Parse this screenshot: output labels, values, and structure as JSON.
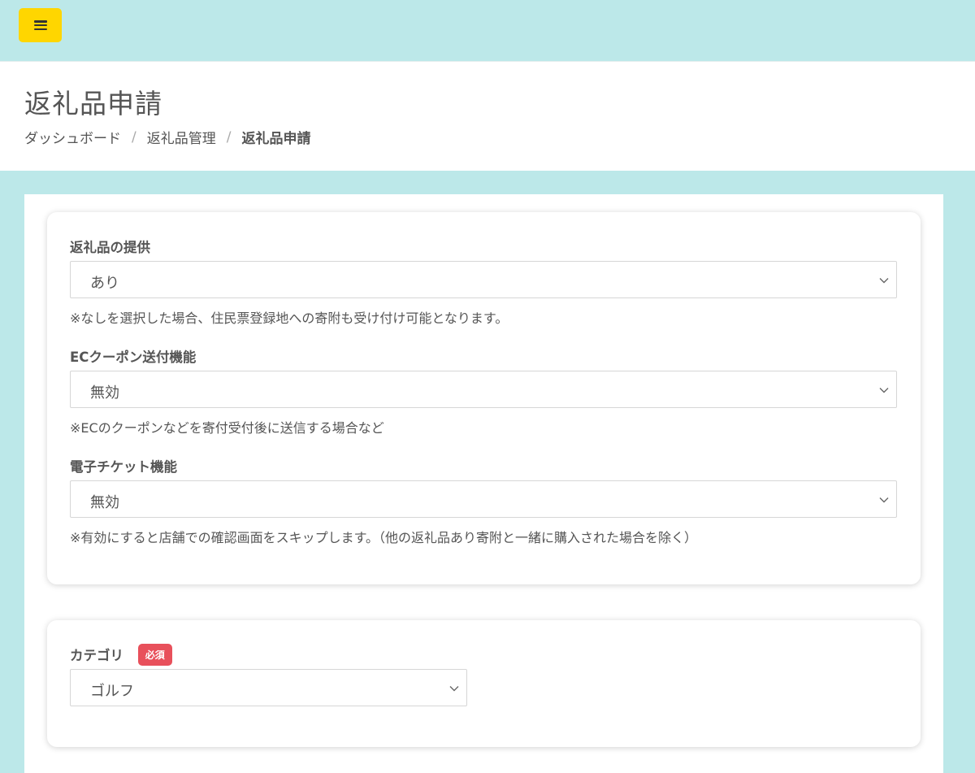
{
  "header": {
    "menu_icon": "hamburger-icon",
    "menu_color": "#ffd600"
  },
  "page": {
    "title": "返礼品申請",
    "breadcrumb": [
      {
        "label": "ダッシュボード"
      },
      {
        "label": "返礼品管理"
      },
      {
        "label": "返礼品申請"
      }
    ],
    "breadcrumb_separator": "/"
  },
  "form": {
    "return_gift": {
      "label": "返礼品の提供",
      "value": "あり",
      "help": "※なしを選択した場合、住民票登録地への寄附も受け付け可能となります。"
    },
    "ec_coupon": {
      "label": "ECクーポン送付機能",
      "value": "無効",
      "help": "※ECのクーポンなどを寄付受付後に送信する場合など"
    },
    "e_ticket": {
      "label": "電子チケット機能",
      "value": "無効",
      "help": "※有効にすると店舗での確認画面をスキップします。（他の返礼品あり寄附と一緒に購入された場合を除く）"
    },
    "category": {
      "label": "カテゴリ",
      "badge": "必須",
      "badge_color": "#e8505b",
      "value": "ゴルフ"
    }
  },
  "colors": {
    "background": "#bce8e9",
    "accent": "#ffd600"
  }
}
